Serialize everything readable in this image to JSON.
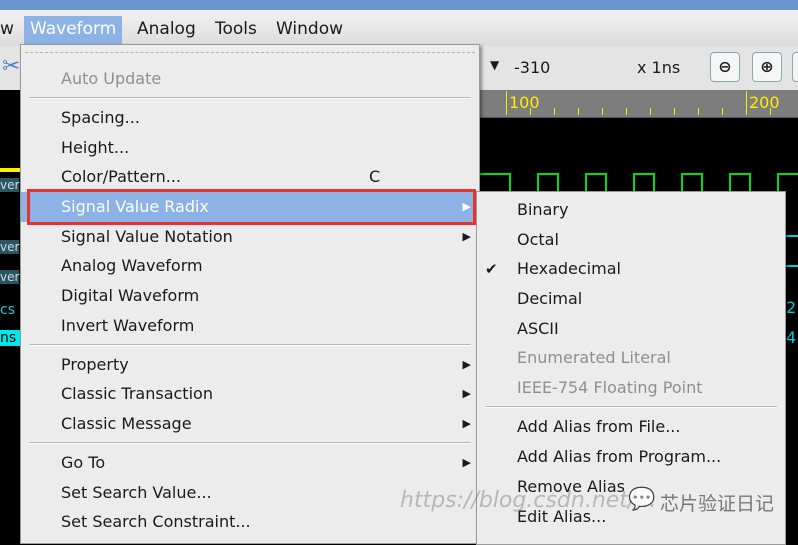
{
  "menubar": {
    "items": [
      {
        "label": "w"
      },
      {
        "label": "Waveform"
      },
      {
        "label": "Analog"
      },
      {
        "label": "Tools"
      },
      {
        "label": "Window"
      }
    ]
  },
  "toolbar": {
    "time_value": "-310",
    "time_unit": "x 1ns",
    "zoom_out_icon": "zoom-out-icon",
    "zoom_in_icon": "zoom-in-icon"
  },
  "ruler": {
    "labels": [
      "100",
      "200"
    ]
  },
  "left_labels": [
    "ver",
    "ver",
    "ver",
    "cs",
    "ns"
  ],
  "right_values": [
    "2",
    "4"
  ],
  "waveform_menu": {
    "items": [
      {
        "label": "Auto Update",
        "disabled": true
      },
      {
        "label": "Spacing..."
      },
      {
        "label": "Height..."
      },
      {
        "label": "Color/Pattern...",
        "shortcut": "C"
      },
      {
        "label": "Signal Value Radix",
        "submenu": true,
        "highlighted": true
      },
      {
        "label": "Signal Value Notation",
        "submenu": true
      },
      {
        "label": "Analog Waveform"
      },
      {
        "label": "Digital Waveform"
      },
      {
        "label": "Invert Waveform"
      },
      {
        "label": "Property",
        "submenu": true
      },
      {
        "label": "Classic Transaction",
        "submenu": true
      },
      {
        "label": "Classic Message",
        "submenu": true
      },
      {
        "label": "Go To",
        "submenu": true
      },
      {
        "label": "Set Search Value..."
      },
      {
        "label": "Set Search Constraint..."
      }
    ]
  },
  "radix_menu": {
    "items": [
      {
        "label": "Binary"
      },
      {
        "label": "Octal"
      },
      {
        "label": "Hexadecimal",
        "checked": true
      },
      {
        "label": "Decimal"
      },
      {
        "label": "ASCII"
      },
      {
        "label": "Enumerated Literal",
        "disabled": true
      },
      {
        "label": "IEEE-754 Floating Point",
        "disabled": true
      },
      {
        "label": "Add Alias from File..."
      },
      {
        "label": "Add Alias from Program..."
      },
      {
        "label": "Remove Alias"
      },
      {
        "label": "Edit Alias..."
      }
    ]
  },
  "watermark": {
    "url": "https://blog.csdn.net/...",
    "brand": "芯片验证日记"
  },
  "colors": {
    "highlight": "#8db3e6",
    "annotation_box": "#e8322e",
    "wave_green": "#00e000",
    "wave_cyan": "#00d0d0",
    "ruler_text": "#ffee00"
  }
}
